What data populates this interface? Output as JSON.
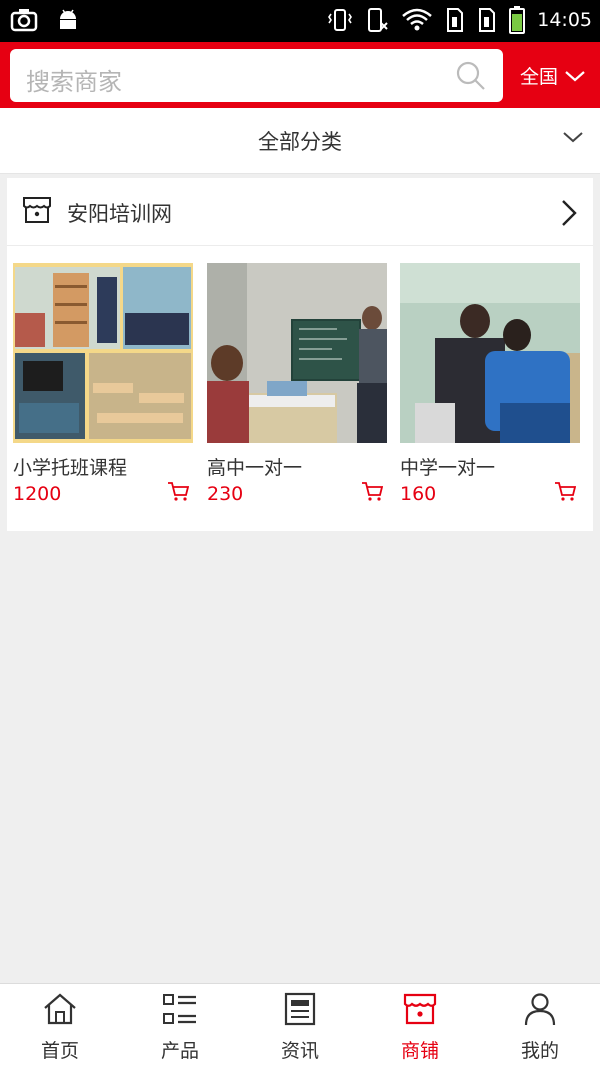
{
  "statusbar": {
    "time": "14:05"
  },
  "search": {
    "placeholder": "搜索商家"
  },
  "region": {
    "label": "全国"
  },
  "category": {
    "label": "全部分类"
  },
  "shop": {
    "name": "安阳培训网"
  },
  "products": [
    {
      "title": "小学托班课程",
      "price": "1200"
    },
    {
      "title": "高中一对一",
      "price": "230"
    },
    {
      "title": "中学一对一",
      "price": "160"
    }
  ],
  "tabs": [
    {
      "label": "首页",
      "icon": "home-icon"
    },
    {
      "label": "产品",
      "icon": "list-icon"
    },
    {
      "label": "资讯",
      "icon": "news-icon"
    },
    {
      "label": "商铺",
      "icon": "store-icon",
      "active": true
    },
    {
      "label": "我的",
      "icon": "user-icon"
    }
  ],
  "colors": {
    "brand": "#e60012",
    "text": "#333333",
    "background": "#efefef"
  }
}
